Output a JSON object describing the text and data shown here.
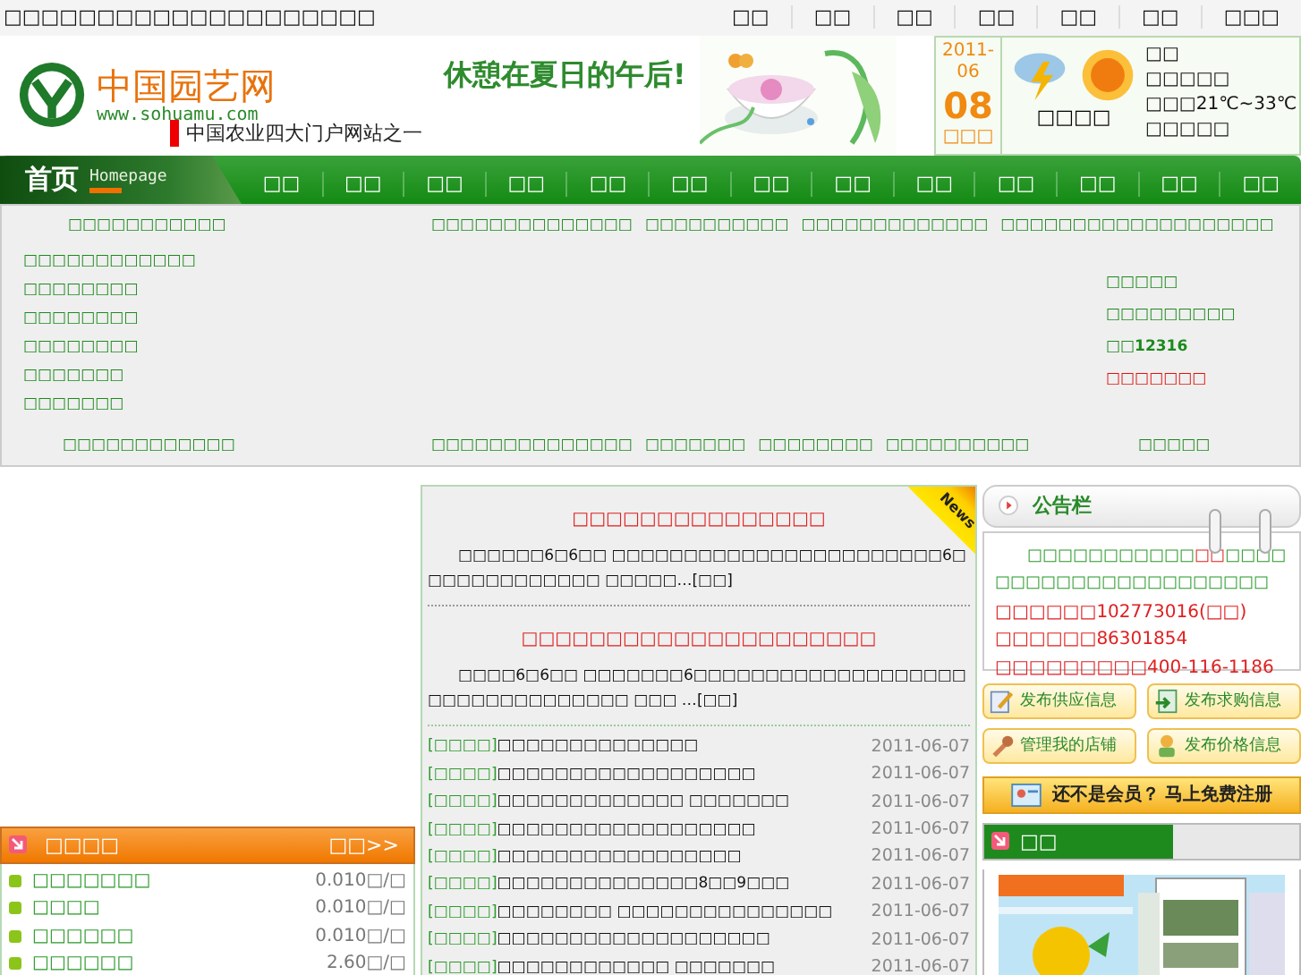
{
  "top_bar": {
    "text": "□□□□□□□□□□□□□□□□□□□□",
    "links": [
      "□□",
      "□□",
      "□□",
      "□□",
      "□□",
      "□□",
      "□□□"
    ]
  },
  "header": {
    "site_name": "中国园艺网",
    "url": "www.sohuamu.com",
    "slogan": "中国农业四大门户网站之一",
    "banner_text": "休憩在夏日的午后!",
    "date": {
      "year": "2011-",
      "month": "06",
      "day": "08",
      "weekday": "□□□"
    },
    "weather": {
      "caption": "□□□□",
      "city": "□□",
      "lines": [
        "□□□□□",
        "□□□21℃~33℃",
        "□□□□□"
      ]
    }
  },
  "nav": {
    "home": "首页",
    "home_sub": "Homepage",
    "items": [
      "□□",
      "□□",
      "□□",
      "□□",
      "□□",
      "□□",
      "□□",
      "□□",
      "□□",
      "□□",
      "□□",
      "□□",
      "□□"
    ]
  },
  "links": {
    "top": {
      "left": "□□□□□□□□□□□",
      "center": [
        "□□□□□□□□□□□□□□",
        "□□□□□□□□□□",
        "□□□□□□□□□□□□□",
        "□□□□□□□□□□"
      ],
      "right": "□□□□□□□□□"
    },
    "left": [
      "□□□□□□□□□□□□",
      "□□□□□□□□",
      "□□□□□□□□",
      "□□□□□□□□",
      "□□□□□□□",
      "□□□□□□□"
    ],
    "right": [
      {
        "text": "□□□□□",
        "kind": "link"
      },
      {
        "text": "□□□□□□□□□",
        "kind": "link"
      },
      {
        "text": "□□12316",
        "kind": "phone"
      },
      {
        "text": "□□□□□□□",
        "kind": "alert"
      }
    ],
    "bottom": {
      "left": "□□□□□□□□□□□□",
      "center": [
        "□□□□□□□□□□□□□□",
        "□□□□□□□",
        "□□□□□□□□",
        "□□□□□□□□□□"
      ],
      "right": "□□□□□"
    }
  },
  "prices": {
    "title": "□□□□",
    "more": "□□>>",
    "rows": [
      {
        "name": "□□□□□□□",
        "price": "0.010□/□"
      },
      {
        "name": "□□□□",
        "price": "0.010□/□"
      },
      {
        "name": "□□□□□□",
        "price": "0.010□/□"
      },
      {
        "name": "□□□□□□",
        "price": "2.60□/□"
      }
    ]
  },
  "news": {
    "badge": "News",
    "featured": [
      {
        "title": "□□□□□□□□□□□□□□□",
        "summary": "□□□□□□6□6□□ □□□□□□□□□□□□□□□□□□□□□□□6□□□□□□□□□□□□□ □□□□□…",
        "more": "[□□]"
      },
      {
        "title": "□□□□□□□□□□□□□□□□□□□□□",
        "summary": "□□□□6□6□□ □□□□□□□6□□□□□□□□□□□□□□□□□□□□□□□□□□□□□□□□□ □□□ …",
        "more": "[□□]"
      }
    ],
    "items": [
      {
        "tag": "[□□□□]",
        "title": "□□□□□□□□□□□□□□",
        "date": "2011-06-07"
      },
      {
        "tag": "[□□□□]",
        "title": "□□□□□□□□□□□□□□□□□□",
        "date": "2011-06-07"
      },
      {
        "tag": "[□□□□]",
        "title": "□□□□□□□□□□□□□ □□□□□□□",
        "date": "2011-06-07"
      },
      {
        "tag": "[□□□□]",
        "title": "□□□□□□□□□□□□□□□□□□",
        "date": "2011-06-07"
      },
      {
        "tag": "[□□□□]",
        "title": "□□□□□□□□□□□□□□□□□",
        "date": "2011-06-07"
      },
      {
        "tag": "[□□□□]",
        "title": "□□□□□□□□□□□□□□8□□9□□□",
        "date": "2011-06-07"
      },
      {
        "tag": "[□□□□]",
        "title": "□□□□□□□□ □□□□□□□□□□□□□□□",
        "date": "2011-06-07"
      },
      {
        "tag": "[□□□□]",
        "title": "□□□□□□□□□□□□□□□□□□□",
        "date": "2011-06-07"
      },
      {
        "tag": "[□□□□]",
        "title": "□□□□□□□□□□□□ □□□□□□□",
        "date": "2011-06-07"
      }
    ]
  },
  "side": {
    "notice": {
      "title": "公告栏",
      "lead": "□□□□□□□□□□□",
      "highlight": "□□",
      "rest": "□□□□□□□□□□□□□□□□□□□□□□",
      "contacts": [
        "□□□□□□102773016(□□)",
        "□□□□□□86301854",
        "□□□□□□□□□400-116-1186"
      ]
    },
    "actions": [
      "发布供应信息",
      "发布求购信息",
      "管理我的店铺",
      "发布价格信息"
    ],
    "register": "还不是会员？ 马上免费注册",
    "box_title": "□□"
  }
}
